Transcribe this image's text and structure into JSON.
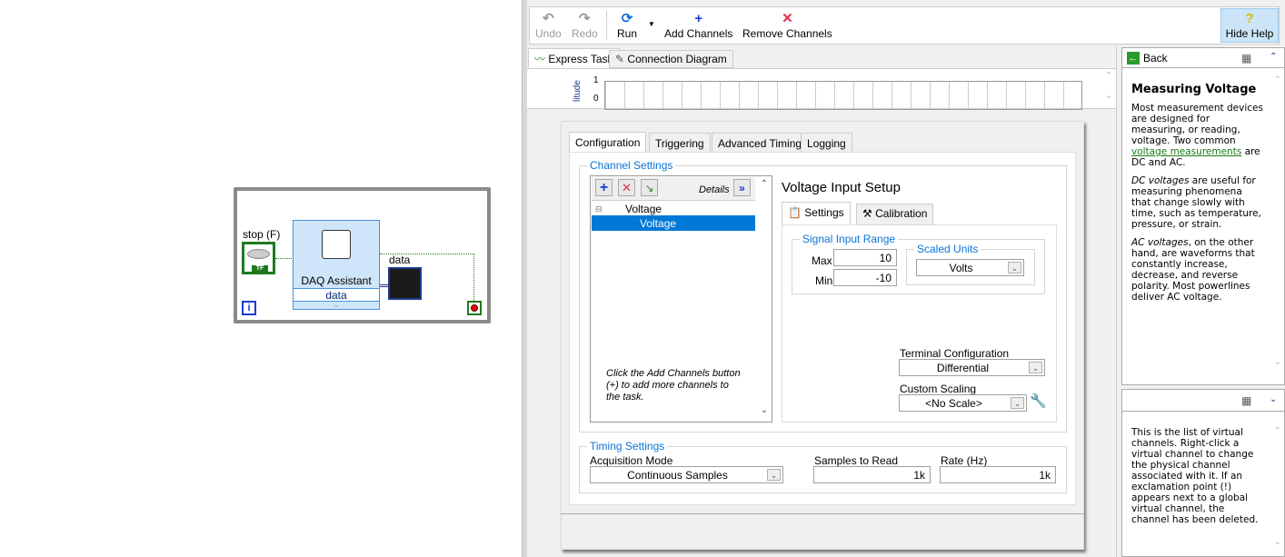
{
  "diagram": {
    "stop_label": "stop (F)",
    "stop_tf": "TF",
    "daq_title": "DAQ Assistant",
    "daq_output": "data",
    "graph_label": "data",
    "iteration": "i"
  },
  "toolbar": {
    "undo": "Undo",
    "redo": "Redo",
    "run": "Run",
    "add_channels": "Add Channels",
    "remove_channels": "Remove Channels",
    "hide_help": "Hide Help"
  },
  "view_tabs": [
    "Express Task",
    "Connection Diagram"
  ],
  "graph": {
    "y_label": "litude",
    "y_ticks": [
      "1",
      "0"
    ]
  },
  "config_tabs": [
    "Configuration",
    "Triggering",
    "Advanced Timing",
    "Logging"
  ],
  "channel_settings": {
    "legend": "Channel Settings",
    "details": "Details",
    "tree_parent": "Voltage",
    "tree_child": "Voltage",
    "hint": "Click the Add Channels button (+) to add more channels to the task."
  },
  "setup": {
    "title": "Voltage Input Setup",
    "tabs": [
      "Settings",
      "Calibration"
    ],
    "signal_range_legend": "Signal Input Range",
    "max_label": "Max",
    "max_value": "10",
    "min_label": "Min",
    "min_value": "-10",
    "scaled_units_legend": "Scaled Units",
    "scaled_units": "Volts",
    "terminal_label": "Terminal Configuration",
    "terminal_value": "Differential",
    "custom_scaling_label": "Custom Scaling",
    "custom_scaling_value": "<No Scale>"
  },
  "timing": {
    "legend": "Timing Settings",
    "acq_label": "Acquisition Mode",
    "acq_value": "Continuous Samples",
    "samples_label": "Samples to Read",
    "samples_value": "1k",
    "rate_label": "Rate (Hz)",
    "rate_value": "1k"
  },
  "help": {
    "back": "Back",
    "title": "Measuring Voltage",
    "p1_a": "Most measurement devices are designed for measuring, or reading, voltage. Two common ",
    "p1_link": "voltage measurements",
    "p1_b": " are DC and AC.",
    "p2_em": "DC voltages",
    "p2": " are useful for measuring phenomena that change slowly with time, such as temperature, pressure, or strain.",
    "p3_em": "AC voltages",
    "p3": ", on the other hand, are waveforms that constantly increase, decrease, and reverse polarity. Most powerlines deliver AC voltage.",
    "context": "This is the list of virtual channels. Right-click a virtual channel to change the physical channel associated with it. If an exclamation point (!) appears next to a global virtual channel, the channel has been deleted."
  }
}
